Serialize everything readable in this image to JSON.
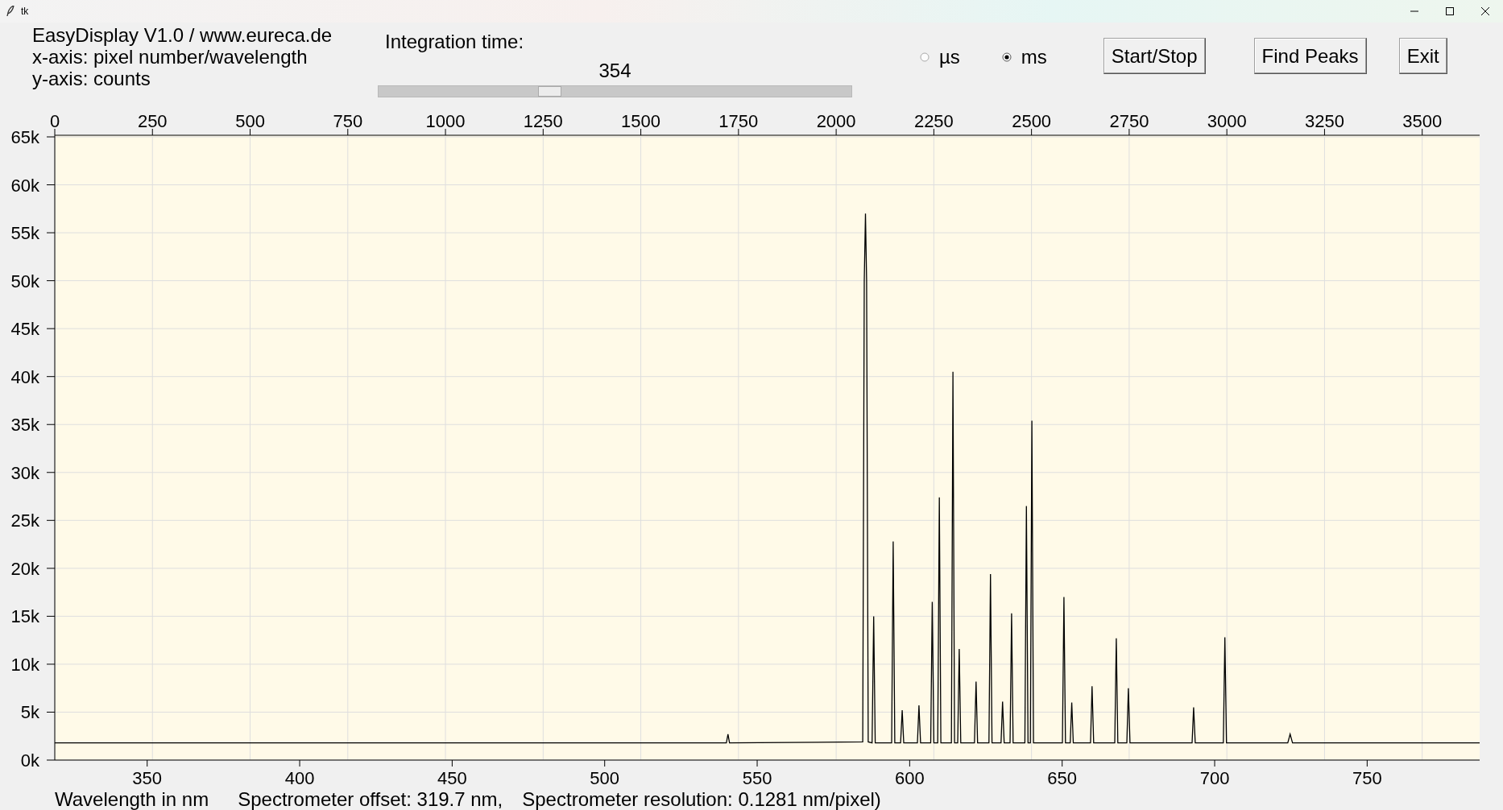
{
  "window": {
    "title": "tk"
  },
  "info_lines": [
    "EasyDisplay V1.0 / www.eureca.de",
    "x-axis: pixel number/wavelength",
    "y-axis: counts"
  ],
  "integration": {
    "label": "Integration time:",
    "value": "354",
    "level": 0.354
  },
  "units": [
    {
      "label": "µs",
      "selected": false
    },
    {
      "label": "ms",
      "selected": true
    }
  ],
  "buttons": [
    "Start/Stop",
    "Find Peaks",
    "Exit"
  ],
  "chart_data": {
    "type": "line",
    "grid": true,
    "xlim": [
      0,
      3647
    ],
    "ylim": [
      0,
      65000
    ],
    "xticks": [
      0,
      250,
      500,
      750,
      1000,
      1250,
      1500,
      1750,
      2000,
      2250,
      2500,
      2750,
      3000,
      3250,
      3500
    ],
    "yticks": [
      {
        "value": 0,
        "label": "0k"
      },
      {
        "value": 5000,
        "label": "5k"
      },
      {
        "value": 10000,
        "label": "10k"
      },
      {
        "value": 15000,
        "label": "15k"
      },
      {
        "value": 20000,
        "label": "20k"
      },
      {
        "value": 25000,
        "label": "25k"
      },
      {
        "value": 30000,
        "label": "30k"
      },
      {
        "value": 35000,
        "label": "35k"
      },
      {
        "value": 40000,
        "label": "40k"
      },
      {
        "value": 45000,
        "label": "45k"
      },
      {
        "value": 50000,
        "label": "50k"
      },
      {
        "value": 55000,
        "label": "55k"
      },
      {
        "value": 60000,
        "label": "60k"
      },
      {
        "value": 65000,
        "label": "65k"
      }
    ],
    "x": [
      0,
      1719,
      1723,
      1727,
      2068,
      2072,
      2075,
      2078,
      2082,
      2092,
      2096,
      2100,
      2142,
      2146,
      2150,
      2165,
      2169,
      2173,
      2208,
      2212,
      2216,
      2242,
      2246,
      2250,
      2260,
      2264,
      2268,
      2295,
      2299,
      2303,
      2311,
      2315,
      2319,
      2354,
      2358,
      2362,
      2391,
      2395,
      2399,
      2422,
      2426,
      2430,
      2445,
      2449,
      2453,
      2483,
      2487,
      2491,
      2497,
      2501,
      2505,
      2579,
      2583,
      2587,
      2599,
      2603,
      2607,
      2651,
      2655,
      2659,
      2713,
      2717,
      2721,
      2744,
      2748,
      2752,
      2911,
      2915,
      2919,
      2991,
      2995,
      2999,
      3156,
      3162,
      3168,
      3647
    ],
    "series": [
      {
        "color": "#000000",
        "values": [
          1800,
          1800,
          2700,
          1800,
          1900,
          50000,
          57000,
          50000,
          1900,
          1800,
          15000,
          1800,
          1800,
          22800,
          1800,
          1800,
          5200,
          1800,
          1800,
          5700,
          1800,
          1800,
          16500,
          1800,
          1800,
          27400,
          1800,
          1800,
          40500,
          1800,
          1800,
          11600,
          1800,
          1800,
          8200,
          1800,
          1800,
          19400,
          1800,
          1800,
          6100,
          1800,
          1800,
          15300,
          1800,
          1800,
          26500,
          1800,
          1800,
          35400,
          1800,
          1800,
          17000,
          1800,
          1800,
          6000,
          1800,
          1800,
          7700,
          1800,
          1800,
          12700,
          1800,
          1800,
          7500,
          1800,
          1800,
          5500,
          1800,
          1800,
          12800,
          1800,
          1800,
          2700,
          1800,
          1800
        ]
      }
    ]
  },
  "wavelength_axis": {
    "ticks": [
      "350",
      "400",
      "450",
      "500",
      "550",
      "600",
      "650",
      "700",
      "750"
    ]
  },
  "footer": [
    "Wavelength in nm",
    "Spectrometer offset: 319.7 nm,",
    "Spectrometer resolution: 0.1281 nm/pixel)"
  ]
}
